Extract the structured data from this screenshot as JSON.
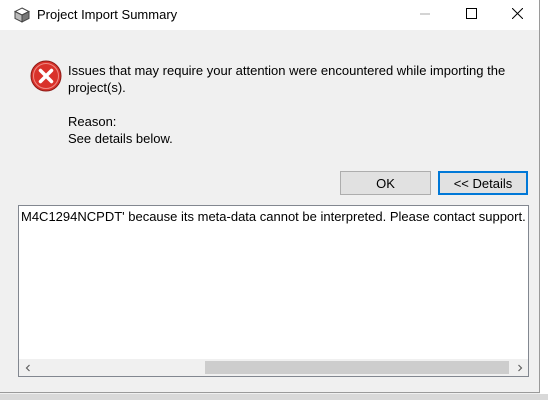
{
  "window": {
    "title": "Project Import Summary"
  },
  "message": {
    "text": "Issues that may require your attention were encountered while importing the project(s).",
    "reason_label": "Reason:",
    "reason_text": "See details below."
  },
  "buttons": {
    "ok_label": "OK",
    "details_label": "<< Details"
  },
  "details": {
    "text": "M4C1294NCPDT' because its meta-data cannot be interpreted. Please contact support."
  },
  "icons": {
    "app": "app-cube-icon",
    "error": "error-icon",
    "minimize": "minimize-icon",
    "maximize": "maximize-icon",
    "close": "close-icon",
    "scroll_left": "chevron-left-icon",
    "scroll_right": "chevron-right-icon"
  },
  "colors": {
    "error_red": "#d9322b",
    "focus_blue": "#0078d7"
  }
}
